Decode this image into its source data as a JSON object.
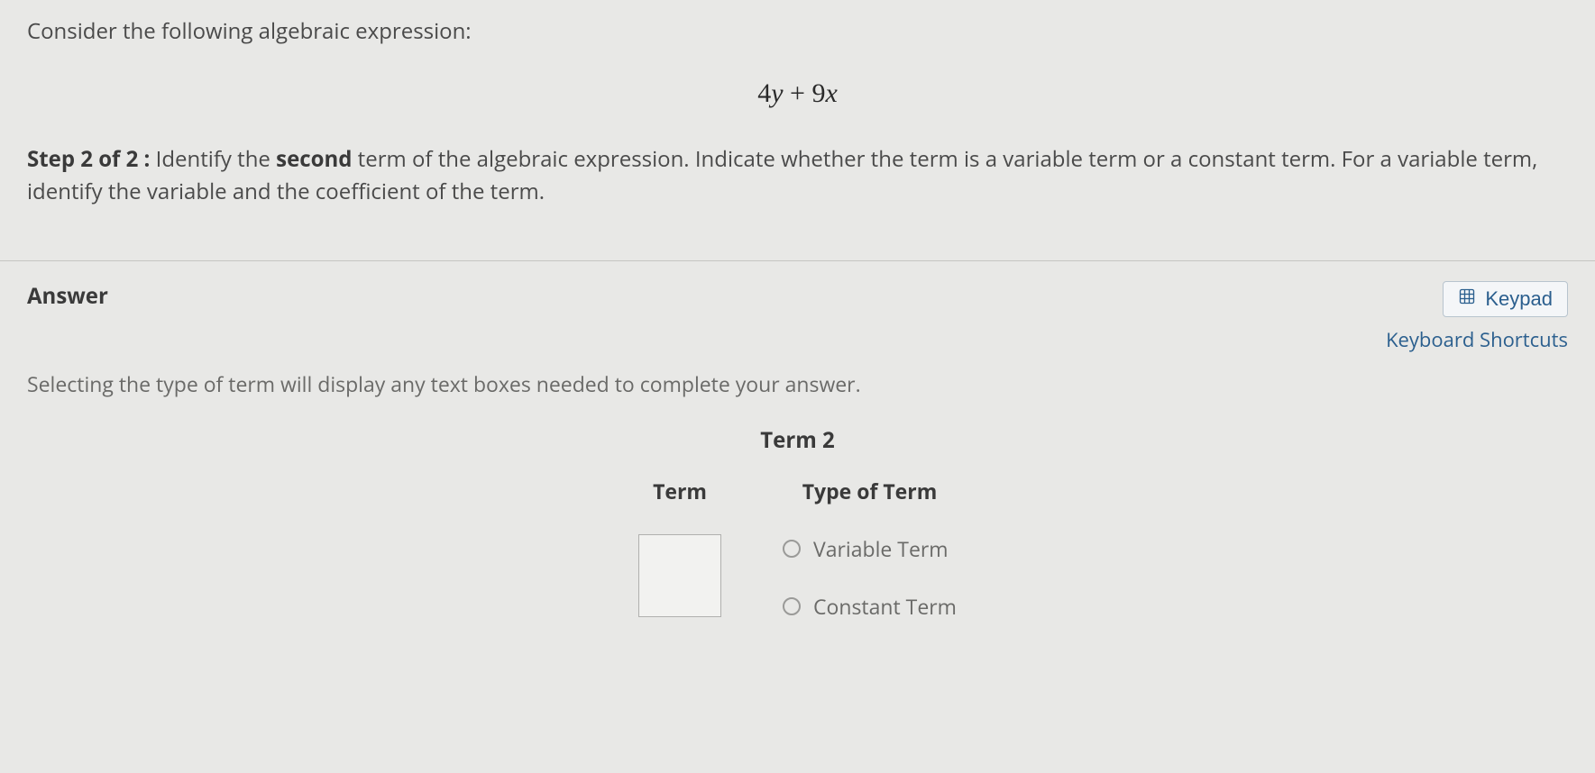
{
  "question": {
    "prompt": "Consider the following algebraic expression:",
    "expression_4": "4",
    "expression_y": "y",
    "expression_plus": " + ",
    "expression_9": "9",
    "expression_x": "x",
    "step_prefix": "Step 2 of 2 :",
    "step_body_1": "  Identify the ",
    "step_bold": "second",
    "step_body_2": " term of the algebraic expression. Indicate whether the term is a variable term or a constant term. For a variable term, identify the variable and the coefficient of the term."
  },
  "answer": {
    "heading": "Answer",
    "keypad_label": "Keypad",
    "shortcuts_label": "Keyboard Shortcuts",
    "instruction": "Selecting the type of term will display any text boxes needed to complete your answer.",
    "term_heading": "Term 2",
    "term_col_label": "Term",
    "type_col_label": "Type of Term",
    "term_value": "",
    "option_variable": "Variable Term",
    "option_constant": "Constant Term"
  }
}
